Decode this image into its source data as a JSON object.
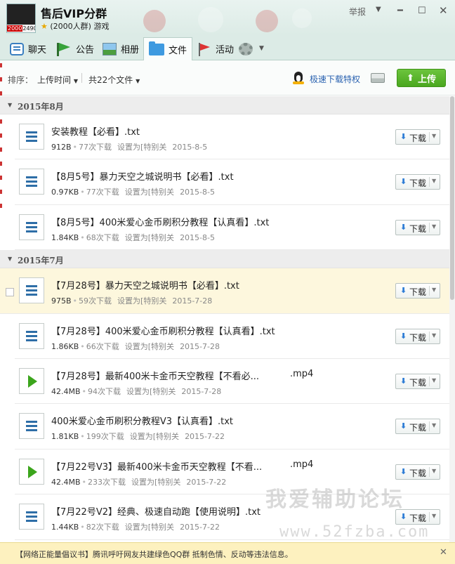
{
  "window": {
    "group_name": "售后VIP分群",
    "group_sub": "(2000人群) 游戏",
    "avatar_number": "2000",
    "avatar_number_rest": "24904",
    "report": "举报"
  },
  "tabs": [
    {
      "label": "聊天",
      "icon": "chat-icon"
    },
    {
      "label": "公告",
      "icon": "notice-flag-icon"
    },
    {
      "label": "相册",
      "icon": "album-icon"
    },
    {
      "label": "文件",
      "icon": "folder-icon",
      "active": true
    },
    {
      "label": "活动",
      "icon": "activity-flag-icon"
    }
  ],
  "toolbar": {
    "sort_label": "排序：",
    "sort_value": "上传时间",
    "file_count": "共22个文件",
    "speed_privilege": "极速下载特权",
    "upload_label": "上传"
  },
  "sections": [
    {
      "label": "2015年8月",
      "files": [
        {
          "name": "安装教程【必看】.txt",
          "ext": "",
          "size": "912B",
          "downloads": "77次下载",
          "setting": "设置为[特别关",
          "date": "2015-8-5",
          "type": "txt"
        },
        {
          "name": "【8月5号】暴力天空之城说明书【必看】.txt",
          "ext": "",
          "size": "0.97KB",
          "downloads": "77次下载",
          "setting": "设置为[特别关",
          "date": "2015-8-5",
          "type": "txt"
        },
        {
          "name": "【8月5号】400米爱心金币刷积分教程【认真看】.txt",
          "ext": "",
          "size": "1.84KB",
          "downloads": "68次下载",
          "setting": "设置为[特别关",
          "date": "2015-8-5",
          "type": "txt"
        }
      ]
    },
    {
      "label": "2015年7月",
      "files": [
        {
          "name": "【7月28号】暴力天空之城说明书【必看】.txt",
          "ext": "",
          "size": "975B",
          "downloads": "59次下载",
          "setting": "设置为[特别关",
          "date": "2015-7-28",
          "type": "txt",
          "highlight": true
        },
        {
          "name": "【7月28号】400米爱心金币刷积分教程【认真看】.txt",
          "ext": "",
          "size": "1.86KB",
          "downloads": "66次下载",
          "setting": "设置为[特别关",
          "date": "2015-7-28",
          "type": "txt"
        },
        {
          "name": "【7月28号】最新400米卡金币天空教程【不看必...",
          "ext": ".mp4",
          "size": "42.4MB",
          "downloads": "94次下载",
          "setting": "设置为[特别关",
          "date": "2015-7-28",
          "type": "video"
        },
        {
          "name": "400米爱心金币刷积分教程V3【认真看】.txt",
          "ext": "",
          "size": "1.81KB",
          "downloads": "199次下载",
          "setting": "设置为[特别关",
          "date": "2015-7-22",
          "type": "txt"
        },
        {
          "name": "【7月22号V3】最新400米卡金币天空教程【不看...",
          "ext": ".mp4",
          "size": "42.4MB",
          "downloads": "233次下载",
          "setting": "设置为[特别关",
          "date": "2015-7-22",
          "type": "video"
        },
        {
          "name": "【7月22号V2】经典、极速自动跑【使用说明】.txt",
          "ext": "",
          "size": "1.44KB",
          "downloads": "82次下载",
          "setting": "设置为[特别关",
          "date": "2015-7-22",
          "type": "txt"
        }
      ]
    }
  ],
  "download_label": "下载",
  "watermark": "我爱辅助论坛",
  "watermark_url": "www.52fzba.com",
  "notice": "【网络正能量倡议书】腾讯呼吁网友共建绿色QQ群 抵制色情、反动等违法信息。"
}
